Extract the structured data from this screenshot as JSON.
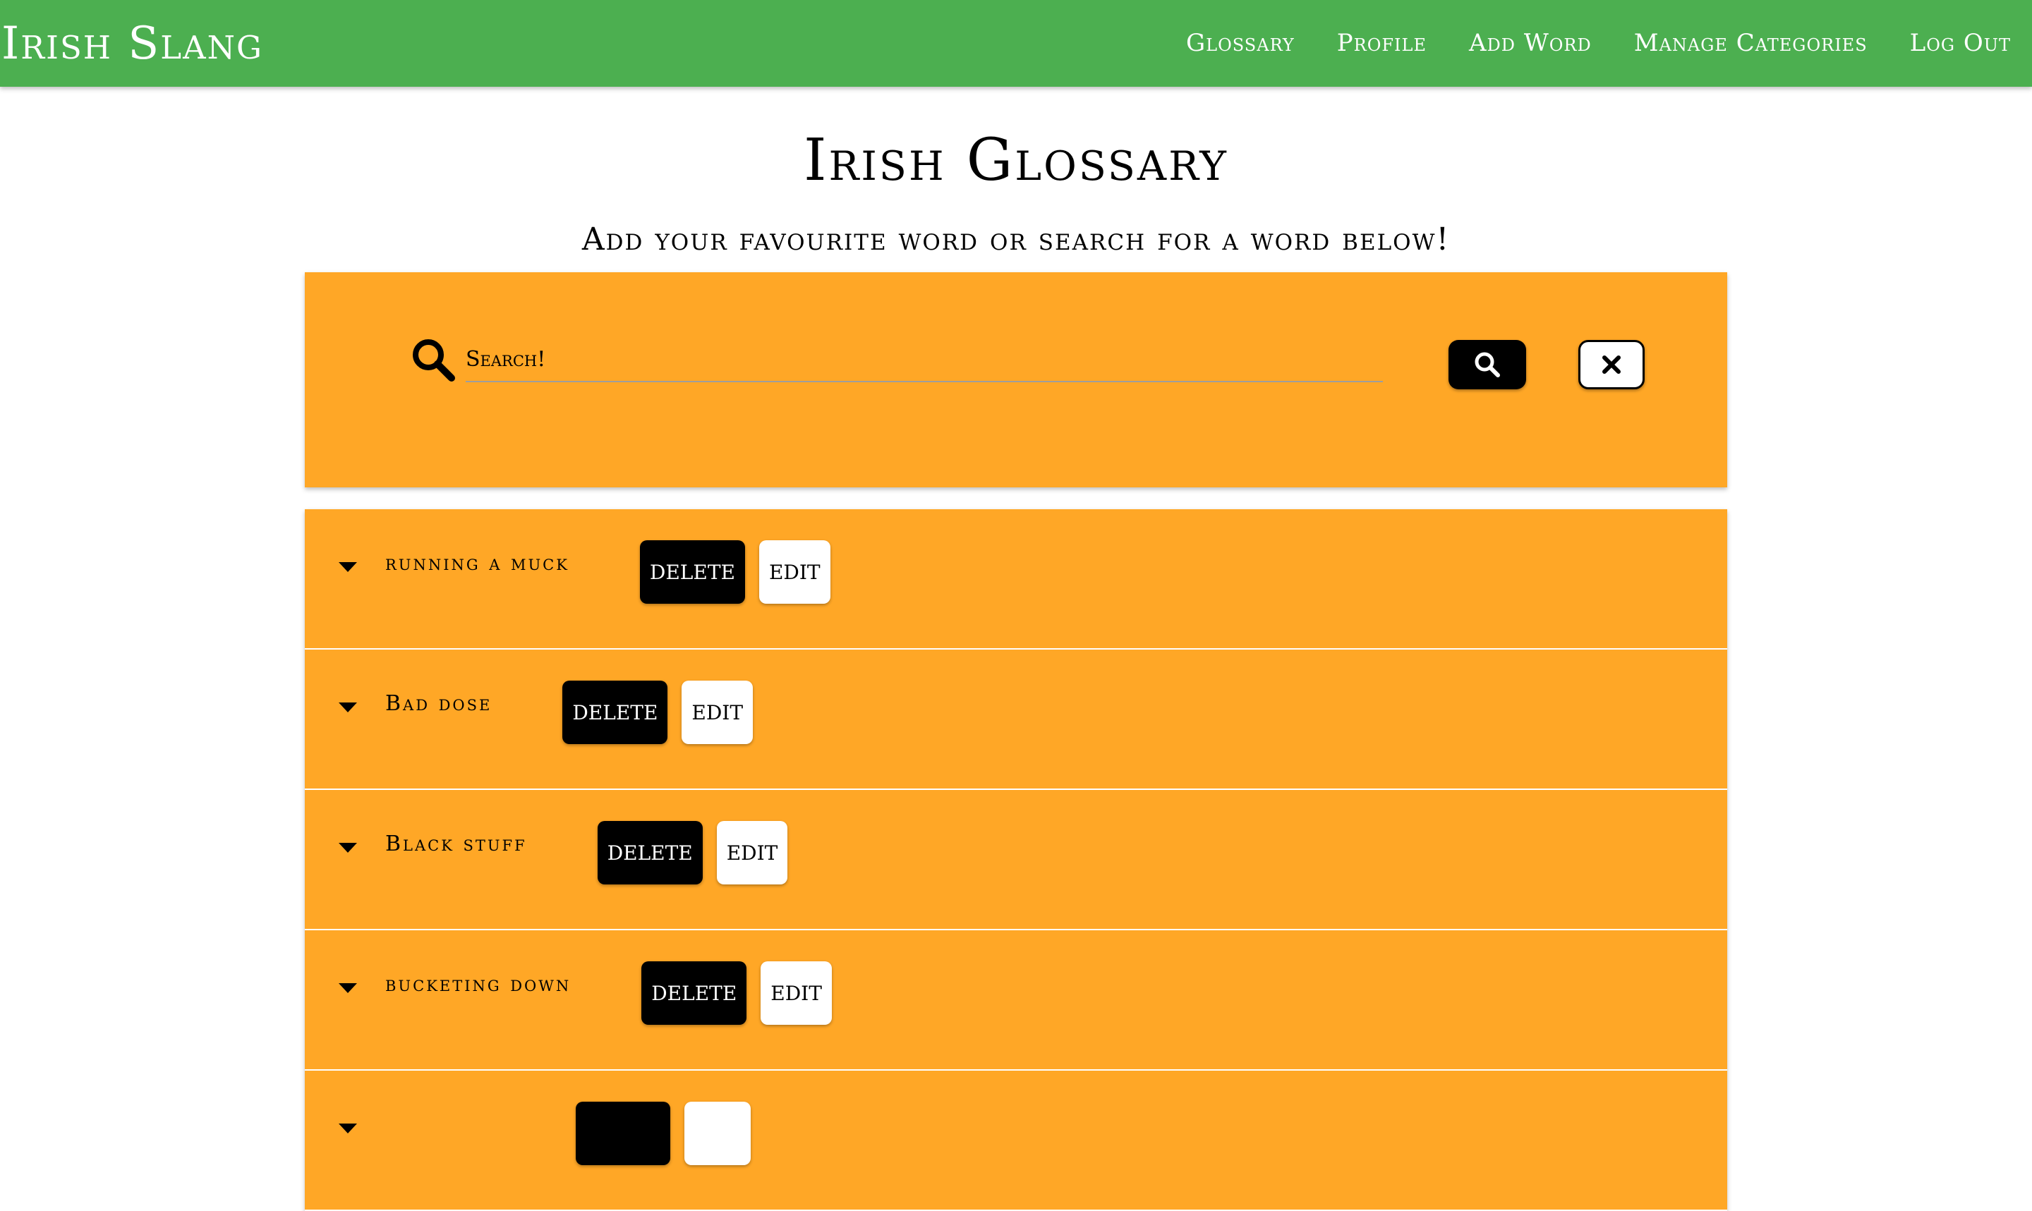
{
  "navbar": {
    "brand": "Irish Slang",
    "links": [
      {
        "label": "Glossary"
      },
      {
        "label": "Profile"
      },
      {
        "label": "Add Word"
      },
      {
        "label": "Manage Categories"
      },
      {
        "label": "Log Out"
      }
    ]
  },
  "page": {
    "title": "Irish Glossary",
    "subtitle": "Add your favourite word or search for a word below!"
  },
  "search": {
    "placeholder": "Search!",
    "value": "",
    "search_icon": "search-icon",
    "clear_icon": "close-icon"
  },
  "words": [
    {
      "term": "running a muck",
      "delete_label": "DELETE",
      "edit_label": "EDIT"
    },
    {
      "term": "Bad dose",
      "delete_label": "DELETE",
      "edit_label": "EDIT"
    },
    {
      "term": "Black stuff",
      "delete_label": "DELETE",
      "edit_label": "EDIT"
    },
    {
      "term": "bucketing down",
      "delete_label": "DELETE",
      "edit_label": "EDIT"
    },
    {
      "term": "",
      "delete_label": "",
      "edit_label": ""
    }
  ],
  "colors": {
    "navbar": "#4caf50",
    "card": "#ffa726",
    "primary_button": "#000000",
    "secondary_button": "#ffffff"
  }
}
